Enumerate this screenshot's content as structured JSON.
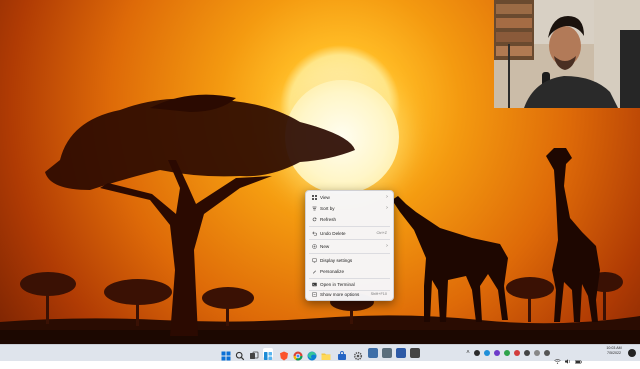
{
  "context_menu": {
    "items": [
      {
        "label": "View",
        "icon": "view-grid-icon",
        "submenu": true
      },
      {
        "label": "Sort by",
        "icon": "sort-icon",
        "submenu": true
      },
      {
        "label": "Refresh",
        "icon": "refresh-icon"
      },
      {
        "label": "Undo Delete",
        "icon": "undo-icon",
        "shortcut": "Ctrl+Z"
      },
      {
        "label": "New",
        "icon": "new-icon",
        "submenu": true
      },
      {
        "label": "Display settings",
        "icon": "display-settings-icon"
      },
      {
        "label": "Personalize",
        "icon": "personalize-icon"
      },
      {
        "label": "Open in Terminal",
        "icon": "terminal-icon"
      },
      {
        "label": "Show more options",
        "icon": "more-options-icon",
        "shortcut": "Shift+F10"
      }
    ]
  },
  "taskbar": {
    "pinned_icons": [
      "start-icon",
      "search-icon",
      "task-view-icon",
      "widgets-icon",
      "brave-browser-icon",
      "chrome-icon",
      "edge-icon",
      "file-explorer-icon",
      "store-icon",
      "settings-icon",
      "app-icon",
      "app-icon",
      "app-icon",
      "app-icon"
    ],
    "tray_icons": [
      "show-hidden-icons-icon",
      "app-tray-icon",
      "app-tray-icon",
      "app-tray-icon",
      "app-tray-icon",
      "app-tray-icon",
      "wifi-icon",
      "volume-icon",
      "battery-icon"
    ],
    "clock": {
      "time": "10:03 AM",
      "date": "7/5/2022"
    }
  },
  "colors": {
    "sky_top": "#3c0d01",
    "sun_glow": "#ffba24",
    "taskbar": "#dfe4ec",
    "menu_bg": "#f6f6f8"
  }
}
